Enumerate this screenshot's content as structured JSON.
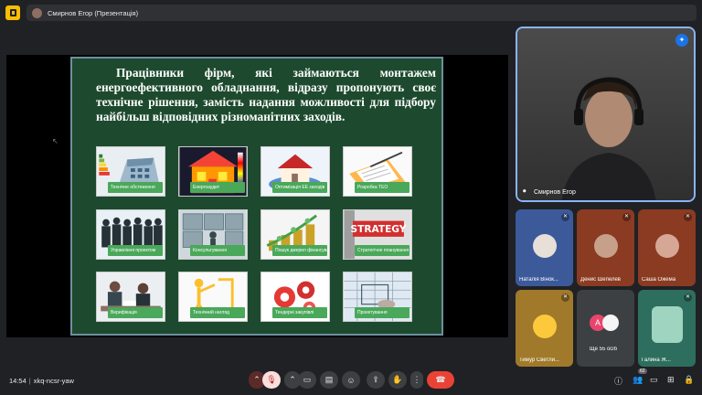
{
  "topbar": {
    "presenter_label": "Смирнов Егор (Презентація)"
  },
  "slide": {
    "title": "Працівники фірм, які займаються монтажем енергоефективного обладнання, відразу пропонують своє технічне рішення, замість надання можливості для підбору найбільш відповідних різноманітних заходів.",
    "tiles": [
      {
        "caption": "Технічне обстеження",
        "icon": "building-energy-label"
      },
      {
        "caption": "Енергоаудит",
        "icon": "thermal-house"
      },
      {
        "caption": "Оптимізація ЕЕ заходів",
        "icon": "house-money"
      },
      {
        "caption": "Розробка ТЕО",
        "icon": "document-pen"
      },
      {
        "caption": "Управління проектом",
        "icon": "business-people"
      },
      {
        "caption": "Консультування",
        "icon": "puzzle-people"
      },
      {
        "caption": "Пошук джерел фінансування",
        "icon": "coin-stacks"
      },
      {
        "caption": "Стратегічне планування",
        "icon": "strategy-sign"
      },
      {
        "caption": "Верифікація",
        "icon": "meeting"
      },
      {
        "caption": "Технічний нагляд",
        "icon": "gear-figure"
      },
      {
        "caption": "Тендерні закупівлі",
        "icon": "red-gears"
      },
      {
        "caption": "Проектування",
        "icon": "blueprint"
      }
    ]
  },
  "self_view": {
    "name": "Смирнов Егор"
  },
  "participants": [
    {
      "name": "Наталія Вінок...",
      "color": "#3c5a9a"
    },
    {
      "name": "Денис Шепелев",
      "color": "#8a3b22"
    },
    {
      "name": "Саша Ожема",
      "color": "#8a3b22"
    },
    {
      "name": "Тимур Светли...",
      "color": "#a07a2a"
    },
    {
      "name": "Ще 55 осіб",
      "color": "#3c4043"
    },
    {
      "name": "Галина Ж...",
      "color": "#2e6e5e"
    }
  ],
  "more_people": {
    "initial": "А"
  },
  "bottombar": {
    "time": "14:54",
    "meeting_code": "xkq-ncsr-yaw",
    "people_count": "62"
  },
  "colors": {
    "accent": "#8ab4f8",
    "end_call": "#ea4335",
    "slide_bg": "#1d4a2e",
    "caption_bg": "#4aa85a"
  }
}
